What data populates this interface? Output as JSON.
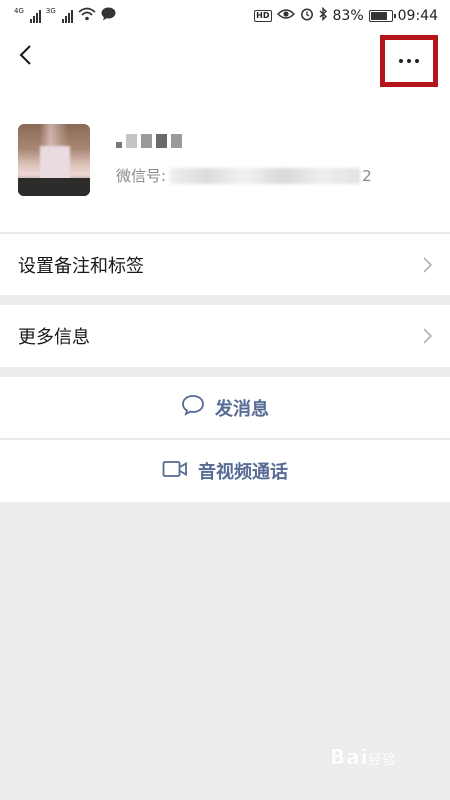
{
  "status_bar": {
    "network_1": "4G",
    "network_2": "3G",
    "battery": "83%",
    "time": "09:44",
    "icons": [
      "signal-icon",
      "wifi-icon",
      "chat-bubble-icon",
      "hd-icon",
      "eye-icon",
      "alarm-icon",
      "bluetooth-icon",
      "battery-icon"
    ],
    "battery_level": 0.83
  },
  "header": {
    "back_icon": "chevron-left-icon",
    "more_icon": "more-dots-icon",
    "highlight_color": "#b3151a"
  },
  "profile": {
    "wechat_id_label": "微信号:",
    "wechat_id_tail": "2"
  },
  "menu": {
    "set_remark_label": "设置备注和标签",
    "more_info_label": "更多信息"
  },
  "actions": {
    "send_message_label": "发消息",
    "video_call_label": "音视频通话",
    "accent_color": "#576b95"
  },
  "watermark": {
    "text": "Bai",
    "suffix": "经验"
  }
}
